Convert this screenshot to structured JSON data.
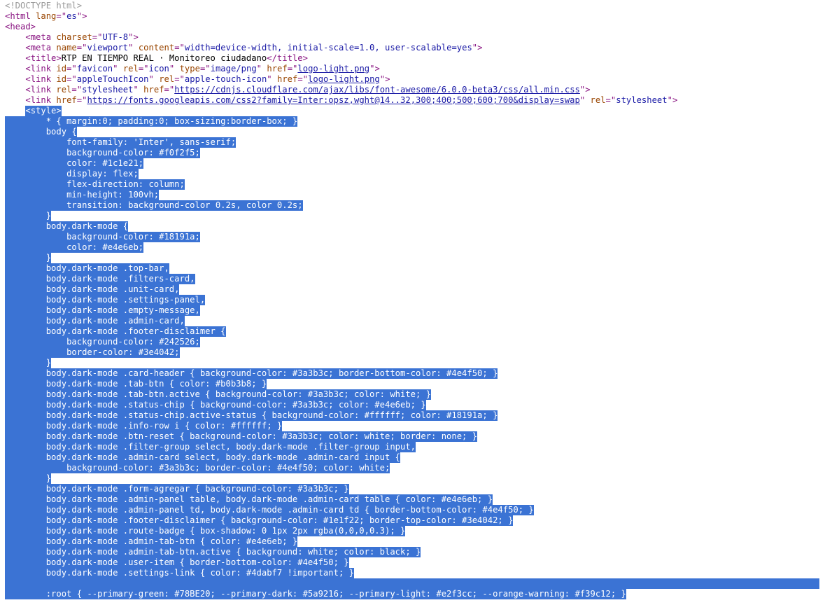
{
  "lines": [
    {
      "indent": 0,
      "parts": [
        [
          "gray",
          "<!DOCTYPE html>"
        ]
      ],
      "sel": false
    },
    {
      "indent": 0,
      "parts": [
        [
          "tag",
          "<html "
        ],
        [
          "attr",
          "lang"
        ],
        [
          "tag",
          "=\""
        ],
        [
          "val",
          "es"
        ],
        [
          "tag",
          "\">"
        ]
      ],
      "sel": false
    },
    {
      "indent": 0,
      "parts": [
        [
          "tag",
          "<head>"
        ]
      ],
      "sel": false
    },
    {
      "indent": 4,
      "parts": [
        [
          "tag",
          "<meta "
        ],
        [
          "attr",
          "charset"
        ],
        [
          "tag",
          "=\""
        ],
        [
          "val",
          "UTF-8"
        ],
        [
          "tag",
          "\">"
        ]
      ],
      "sel": false
    },
    {
      "indent": 4,
      "parts": [
        [
          "tag",
          "<meta "
        ],
        [
          "attr",
          "name"
        ],
        [
          "tag",
          "=\""
        ],
        [
          "val",
          "viewport"
        ],
        [
          "tag",
          "\" "
        ],
        [
          "attr",
          "content"
        ],
        [
          "tag",
          "=\""
        ],
        [
          "val",
          "width=device-width, initial-scale=1.0, user-scalable=yes"
        ],
        [
          "tag",
          "\">"
        ]
      ],
      "sel": false
    },
    {
      "indent": 4,
      "parts": [
        [
          "tag",
          "<title>"
        ],
        [
          "plain",
          "RTP EN TIEMPO REAL · Monitoreo ciudadano"
        ],
        [
          "tag",
          "</title>"
        ]
      ],
      "sel": false
    },
    {
      "indent": 4,
      "parts": [
        [
          "tag",
          "<link "
        ],
        [
          "attr",
          "id"
        ],
        [
          "tag",
          "=\""
        ],
        [
          "val",
          "favicon"
        ],
        [
          "tag",
          "\" "
        ],
        [
          "attr",
          "rel"
        ],
        [
          "tag",
          "=\""
        ],
        [
          "val",
          "icon"
        ],
        [
          "tag",
          "\" "
        ],
        [
          "attr",
          "type"
        ],
        [
          "tag",
          "=\""
        ],
        [
          "val",
          "image/png"
        ],
        [
          "tag",
          "\" "
        ],
        [
          "attr",
          "href"
        ],
        [
          "tag",
          "=\""
        ],
        [
          "link",
          "logo-light.png"
        ],
        [
          "tag",
          "\">"
        ]
      ],
      "sel": false
    },
    {
      "indent": 4,
      "parts": [
        [
          "tag",
          "<link "
        ],
        [
          "attr",
          "id"
        ],
        [
          "tag",
          "=\""
        ],
        [
          "val",
          "appleTouchIcon"
        ],
        [
          "tag",
          "\" "
        ],
        [
          "attr",
          "rel"
        ],
        [
          "tag",
          "=\""
        ],
        [
          "val",
          "apple-touch-icon"
        ],
        [
          "tag",
          "\" "
        ],
        [
          "attr",
          "href"
        ],
        [
          "tag",
          "=\""
        ],
        [
          "link",
          "logo-light.png"
        ],
        [
          "tag",
          "\">"
        ]
      ],
      "sel": false
    },
    {
      "indent": 4,
      "parts": [
        [
          "tag",
          "<link "
        ],
        [
          "attr",
          "rel"
        ],
        [
          "tag",
          "=\""
        ],
        [
          "val",
          "stylesheet"
        ],
        [
          "tag",
          "\" "
        ],
        [
          "attr",
          "href"
        ],
        [
          "tag",
          "=\""
        ],
        [
          "link",
          "https://cdnjs.cloudflare.com/ajax/libs/font-awesome/6.0.0-beta3/css/all.min.css"
        ],
        [
          "tag",
          "\">"
        ]
      ],
      "sel": false
    },
    {
      "indent": 4,
      "parts": [
        [
          "tag",
          "<link "
        ],
        [
          "attr",
          "href"
        ],
        [
          "tag",
          "=\""
        ],
        [
          "link",
          "https://fonts.googleapis.com/css2?family=Inter:opsz,wght@14..32,300;400;500;600;700&display=swap"
        ],
        [
          "tag",
          "\" "
        ],
        [
          "attr",
          "rel"
        ],
        [
          "tag",
          "=\""
        ],
        [
          "val",
          "stylesheet"
        ],
        [
          "tag",
          "\">"
        ]
      ],
      "sel": false
    },
    {
      "indent": 4,
      "parts": [
        [
          "hltag",
          "<style>"
        ]
      ],
      "sel": "lead"
    },
    {
      "indent": 8,
      "parts": [
        [
          "hl",
          "* { margin:0; padding:0; box-sizing:border-box; }"
        ]
      ],
      "sel": true
    },
    {
      "indent": 8,
      "parts": [
        [
          "hl",
          "body {"
        ]
      ],
      "sel": true
    },
    {
      "indent": 12,
      "parts": [
        [
          "hl",
          "font-family: 'Inter', sans-serif;"
        ]
      ],
      "sel": true
    },
    {
      "indent": 12,
      "parts": [
        [
          "hl",
          "background-color: #f0f2f5;"
        ]
      ],
      "sel": true
    },
    {
      "indent": 12,
      "parts": [
        [
          "hl",
          "color: #1c1e21;"
        ]
      ],
      "sel": true
    },
    {
      "indent": 12,
      "parts": [
        [
          "hl",
          "display: flex;"
        ]
      ],
      "sel": true
    },
    {
      "indent": 12,
      "parts": [
        [
          "hl",
          "flex-direction: column;"
        ]
      ],
      "sel": true
    },
    {
      "indent": 12,
      "parts": [
        [
          "hl",
          "min-height: 100vh;"
        ]
      ],
      "sel": true
    },
    {
      "indent": 12,
      "parts": [
        [
          "hl",
          "transition: background-color 0.2s, color 0.2s;"
        ]
      ],
      "sel": true
    },
    {
      "indent": 8,
      "parts": [
        [
          "hl",
          "}"
        ]
      ],
      "sel": true
    },
    {
      "indent": 8,
      "parts": [
        [
          "hl",
          "body.dark-mode {"
        ]
      ],
      "sel": true
    },
    {
      "indent": 12,
      "parts": [
        [
          "hl",
          "background-color: #18191a;"
        ]
      ],
      "sel": true
    },
    {
      "indent": 12,
      "parts": [
        [
          "hl",
          "color: #e4e6eb;"
        ]
      ],
      "sel": true
    },
    {
      "indent": 8,
      "parts": [
        [
          "hl",
          "}"
        ]
      ],
      "sel": true
    },
    {
      "indent": 8,
      "parts": [
        [
          "hl",
          "body.dark-mode .top-bar,"
        ]
      ],
      "sel": true
    },
    {
      "indent": 8,
      "parts": [
        [
          "hl",
          "body.dark-mode .filters-card,"
        ]
      ],
      "sel": true
    },
    {
      "indent": 8,
      "parts": [
        [
          "hl",
          "body.dark-mode .unit-card,"
        ]
      ],
      "sel": true
    },
    {
      "indent": 8,
      "parts": [
        [
          "hl",
          "body.dark-mode .settings-panel,"
        ]
      ],
      "sel": true
    },
    {
      "indent": 8,
      "parts": [
        [
          "hl",
          "body.dark-mode .empty-message,"
        ]
      ],
      "sel": true
    },
    {
      "indent": 8,
      "parts": [
        [
          "hl",
          "body.dark-mode .admin-card,"
        ]
      ],
      "sel": true
    },
    {
      "indent": 8,
      "parts": [
        [
          "hl",
          "body.dark-mode .footer-disclaimer {"
        ]
      ],
      "sel": true
    },
    {
      "indent": 12,
      "parts": [
        [
          "hl",
          "background-color: #242526;"
        ]
      ],
      "sel": true
    },
    {
      "indent": 12,
      "parts": [
        [
          "hl",
          "border-color: #3e4042;"
        ]
      ],
      "sel": true
    },
    {
      "indent": 8,
      "parts": [
        [
          "hl",
          "}"
        ]
      ],
      "sel": true
    },
    {
      "indent": 8,
      "parts": [
        [
          "hl",
          "body.dark-mode .card-header { background-color: #3a3b3c; border-bottom-color: #4e4f50; }"
        ]
      ],
      "sel": true
    },
    {
      "indent": 8,
      "parts": [
        [
          "hl",
          "body.dark-mode .tab-btn { color: #b0b3b8; }"
        ]
      ],
      "sel": true
    },
    {
      "indent": 8,
      "parts": [
        [
          "hl",
          "body.dark-mode .tab-btn.active { background-color: #3a3b3c; color: white; }"
        ]
      ],
      "sel": true
    },
    {
      "indent": 8,
      "parts": [
        [
          "hl",
          "body.dark-mode .status-chip { background-color: #3a3b3c; color: #e4e6eb; }"
        ]
      ],
      "sel": true
    },
    {
      "indent": 8,
      "parts": [
        [
          "hl",
          "body.dark-mode .status-chip.active-status { background-color: #ffffff; color: #18191a; }"
        ]
      ],
      "sel": true
    },
    {
      "indent": 8,
      "parts": [
        [
          "hl",
          "body.dark-mode .info-row i { color: #ffffff; }"
        ]
      ],
      "sel": true
    },
    {
      "indent": 8,
      "parts": [
        [
          "hl",
          "body.dark-mode .btn-reset { background-color: #3a3b3c; color: white; border: none; }"
        ]
      ],
      "sel": true
    },
    {
      "indent": 8,
      "parts": [
        [
          "hl",
          "body.dark-mode .filter-group select, body.dark-mode .filter-group input,"
        ]
      ],
      "sel": true
    },
    {
      "indent": 8,
      "parts": [
        [
          "hl",
          "body.dark-mode .admin-card select, body.dark-mode .admin-card input {"
        ]
      ],
      "sel": true
    },
    {
      "indent": 12,
      "parts": [
        [
          "hl",
          "background-color: #3a3b3c; border-color: #4e4f50; color: white;"
        ]
      ],
      "sel": true
    },
    {
      "indent": 8,
      "parts": [
        [
          "hl",
          "}"
        ]
      ],
      "sel": true
    },
    {
      "indent": 8,
      "parts": [
        [
          "hl",
          "body.dark-mode .form-agregar { background-color: #3a3b3c; }"
        ]
      ],
      "sel": true
    },
    {
      "indent": 8,
      "parts": [
        [
          "hl",
          "body.dark-mode .admin-panel table, body.dark-mode .admin-card table { color: #e4e6eb; }"
        ]
      ],
      "sel": true
    },
    {
      "indent": 8,
      "parts": [
        [
          "hl",
          "body.dark-mode .admin-panel td, body.dark-mode .admin-card td { border-bottom-color: #4e4f50; }"
        ]
      ],
      "sel": true
    },
    {
      "indent": 8,
      "parts": [
        [
          "hl",
          "body.dark-mode .footer-disclaimer { background-color: #1e1f22; border-top-color: #3e4042; }"
        ]
      ],
      "sel": true
    },
    {
      "indent": 8,
      "parts": [
        [
          "hl",
          "body.dark-mode .route-badge { box-shadow: 0 1px 2px rgba(0,0,0,0.3); }"
        ]
      ],
      "sel": true
    },
    {
      "indent": 8,
      "parts": [
        [
          "hl",
          "body.dark-mode .admin-tab-btn { color: #e4e6eb; }"
        ]
      ],
      "sel": true
    },
    {
      "indent": 8,
      "parts": [
        [
          "hl",
          "body.dark-mode .admin-tab-btn.active { background: white; color: black; }"
        ]
      ],
      "sel": true
    },
    {
      "indent": 8,
      "parts": [
        [
          "hl",
          "body.dark-mode .user-item { border-bottom-color: #4e4f50; }"
        ]
      ],
      "sel": true
    },
    {
      "indent": 8,
      "parts": [
        [
          "hl",
          "body.dark-mode .settings-link { color: #4dabf7 !important; }"
        ]
      ],
      "sel": true
    },
    {
      "indent": 0,
      "parts": [],
      "sel": "blank"
    },
    {
      "indent": 8,
      "parts": [
        [
          "hl",
          ":root { --primary-green: #78BE20; --primary-dark: #5a9216; --primary-light: #e2f3cc; --orange-warning: #f39c12; }"
        ]
      ],
      "sel": true
    }
  ],
  "colors": {
    "selection": "#3b73d4",
    "tag": "#881280",
    "attr": "#994500",
    "value": "#1a1aa6",
    "comment": "#999999"
  }
}
